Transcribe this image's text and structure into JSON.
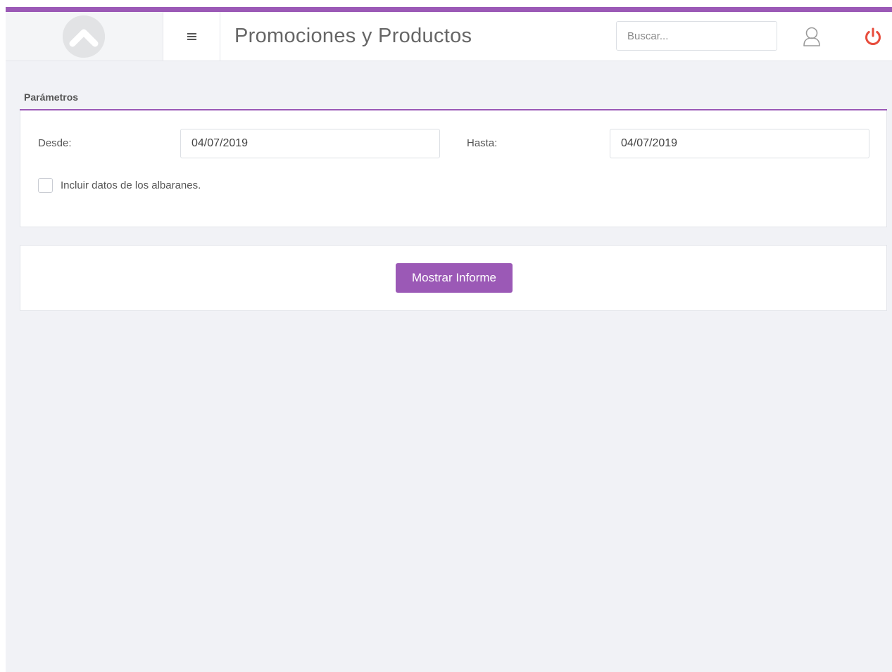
{
  "header": {
    "title": "Promociones y Productos",
    "search_placeholder": "Buscar...",
    "icons": {
      "logo": "logo-icon",
      "menu": "hamburger-icon",
      "user": "user-icon",
      "power": "power-icon"
    }
  },
  "parameters": {
    "title": "Parámetros",
    "from_label": "Desde:",
    "from_value": "04/07/2019",
    "to_label": "Hasta:",
    "to_value": "04/07/2019",
    "include_label": "Incluir datos de los albaranes.",
    "include_checked": false
  },
  "actions": {
    "show_report_label": "Mostrar Informe"
  },
  "colors": {
    "accent": "#9b59b6",
    "power": "#e74c3c",
    "background": "#f1f2f6"
  }
}
